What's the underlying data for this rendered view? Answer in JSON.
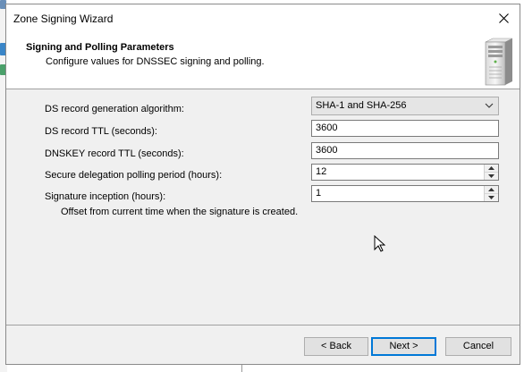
{
  "window": {
    "title": "Zone Signing Wizard"
  },
  "header": {
    "title": "Signing and Polling Parameters",
    "subtitle": "Configure values for DNSSEC signing and polling.",
    "icon": "server-tower-icon"
  },
  "form": {
    "ds_algorithm": {
      "label": "DS record generation algorithm:",
      "selected": "SHA-1 and SHA-256"
    },
    "ds_ttl": {
      "label": "DS record TTL (seconds):",
      "value": "3600"
    },
    "dnskey_ttl": {
      "label": "DNSKEY record TTL (seconds):",
      "value": "3600"
    },
    "polling_period": {
      "label": "Secure delegation polling period (hours):",
      "value": "12"
    },
    "signature_inception": {
      "label": "Signature inception (hours):",
      "value": "1",
      "note": "Offset from current time when the signature is created."
    }
  },
  "buttons": {
    "back": "< Back",
    "next": "Next >",
    "cancel": "Cancel"
  },
  "colors": {
    "dialog_bg": "#f0f0f0",
    "header_bg": "#ffffff",
    "default_button_border": "#0078d7"
  }
}
